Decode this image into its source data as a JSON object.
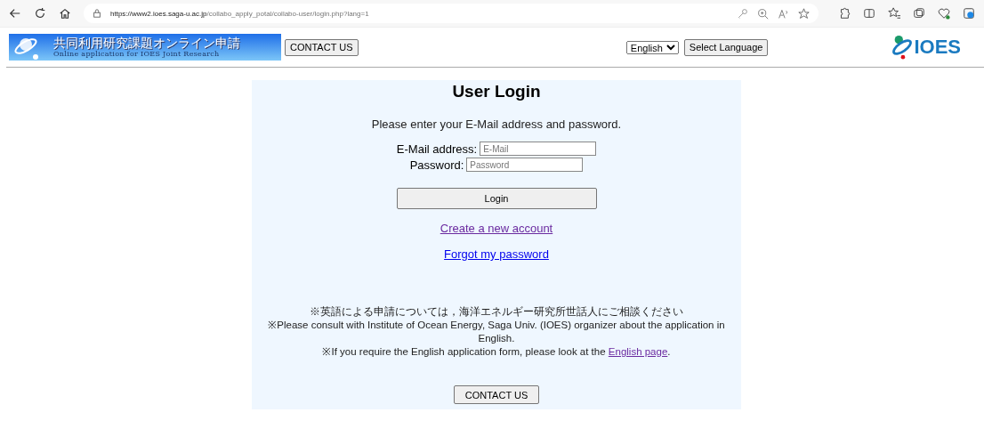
{
  "browser": {
    "url_host": "https://www2.ioes.saga-u.ac.jp",
    "url_path": "/collabo_apply_potal/collabo-user/login.php?lang=1"
  },
  "header": {
    "banner_title": "共同利用研究課題オンライン申請",
    "banner_subtitle": "Online application for IOES Joint Research",
    "contact_button": "CONTACT US",
    "language_select": "English",
    "language_button": "Select Language",
    "logo_text": "IOES"
  },
  "login": {
    "title": "User Login",
    "instruction": "Please enter your E-Mail address and password.",
    "fields": [
      {
        "label": "E-Mail address:",
        "placeholder": "E-Mail"
      },
      {
        "label": "Password:",
        "placeholder": "Password"
      }
    ],
    "login_button": "Login",
    "links": [
      {
        "text": "Create a new account",
        "visited": true
      },
      {
        "text": "Forgot my password",
        "visited": false
      }
    ],
    "notes": [
      {
        "text": "※英語による申請については，海洋エネルギー研究所世話人にご相談ください"
      },
      {
        "text": "※Please consult with Institute of Ocean Energy, Saga Univ. (IOES) organizer about the application in English."
      },
      {
        "text": "※If you require the English application form, please look at the ",
        "link": "English page",
        "link_visited": true,
        "after": "."
      }
    ],
    "contact_button": "CONTACT US"
  }
}
